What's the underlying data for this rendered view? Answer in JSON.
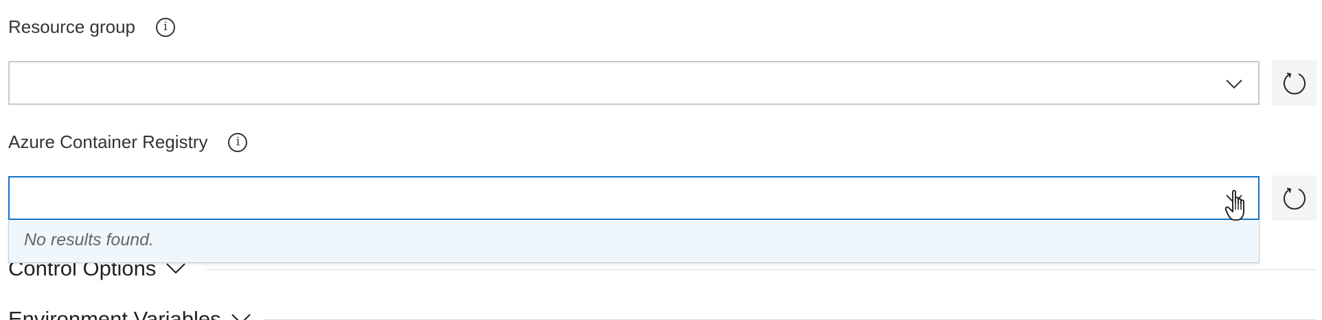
{
  "fields": [
    {
      "label": "Resource group",
      "info_icon": "info-circle-icon",
      "value": "",
      "state": "collapsed",
      "chevron_icon": "chevron-down-icon",
      "refresh_icon": "refresh-icon"
    },
    {
      "label": "Azure Container Registry",
      "info_icon": "info-circle-icon",
      "value": "",
      "state": "focused-open",
      "chevron_icon": "chevron-down-icon",
      "refresh_icon": "refresh-icon"
    }
  ],
  "results_popup": {
    "message": "No results found."
  },
  "sections": [
    {
      "label": "Control Options",
      "icon": "chevron-down-icon"
    },
    {
      "label": "Environment Variables",
      "icon": "chevron-down-icon"
    }
  ],
  "info_glyph": "i",
  "cursor_icon": "hand-pointer-icon",
  "colors": {
    "focus_border": "#1070c8",
    "default_border": "#c8c8c8",
    "popup_background": "#eff6fc",
    "refresh_background": "#f4f4f4",
    "text": "#333333"
  }
}
